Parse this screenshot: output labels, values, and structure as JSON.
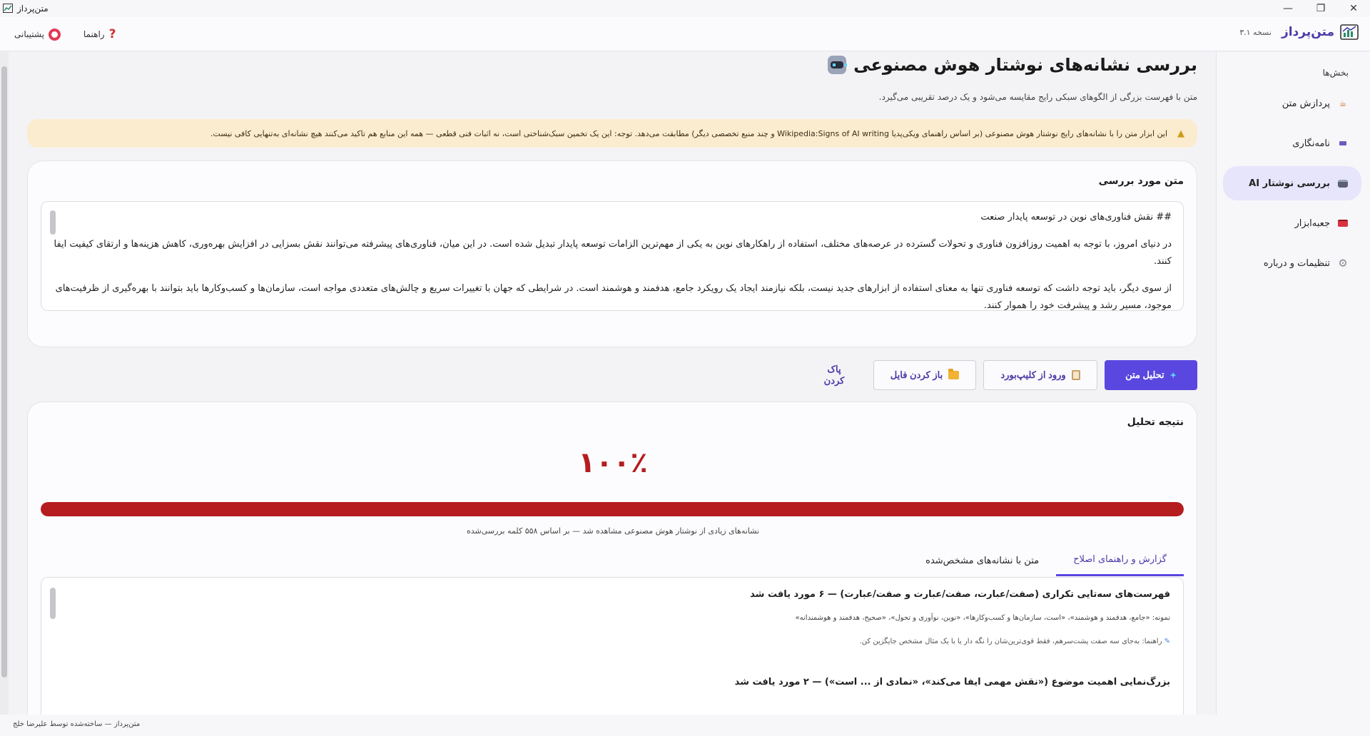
{
  "window": {
    "title": "متن‌پرداز",
    "minimize": "—",
    "restore": "❐",
    "close": "✕"
  },
  "header": {
    "brand_name": "متن‌پرداز",
    "version": "نسخه ۳.۱",
    "help_label": "راهنما",
    "support_label": "پشتیبانی"
  },
  "sidebar": {
    "heading": "بخش‌ها",
    "items": [
      {
        "label": "پردازش متن",
        "icon": "text-processing-icon",
        "active": false
      },
      {
        "label": "نامه‌نگاری",
        "icon": "letter-icon",
        "active": false
      },
      {
        "label": "بررسی نوشتار AI",
        "icon": "robot-icon",
        "active": true
      },
      {
        "label": "جعبه‌ابزار",
        "icon": "toolbox-icon",
        "active": false
      },
      {
        "label": "تنظیمات و درباره",
        "icon": "gear-icon",
        "active": false
      }
    ]
  },
  "main": {
    "title": "بررسی نشانه‌های نوشتار هوش مصنوعی",
    "subtitle": "متن با فهرست بزرگی از الگوهای سبکی رایج مقایسه می‌شود و یک درصد تقریبی می‌گیرد.",
    "alert": "این ابزار متن را با نشانه‌های رایج نوشتار هوش مصنوعی (بر اساس راهنمای ویکی‌پدیا Wikipedia:Signs of AI writing و چند منبع تخصصی دیگر) مطابقت می‌دهد. توجه: این یک تخمین سبک‌شناختی است، نه اثبات فنی قطعی — همه این منابع هم تاکید می‌کنند هیچ نشانه‌ای به‌تنهایی کافی نیست.",
    "input_card": {
      "title": "متن مورد بررسی",
      "paragraphs": [
        "## نقش فناوری‌های نوین در توسعه پایدار صنعت",
        "در دنیای امروز، با توجه به اهمیت روزافزون فناوری و تحولات گسترده در عرصه‌های مختلف، استفاده از راهکارهای نوین به یکی از مهم‌ترین الزامات توسعه پایدار تبدیل شده است. در این میان، فناوری‌های پیشرفته می‌توانند نقش بسزایی در افزایش بهره‌وری، کاهش هزینه‌ها و ارتقای کیفیت ایفا کنند.",
        "از سوی دیگر، باید توجه داشت که توسعه فناوری تنها به معنای استفاده از ابزارهای جدید نیست، بلکه نیازمند ایجاد یک رویکرد جامع، هدفمند و هوشمند است. در شرایطی که جهان با تغییرات سریع و چالش‌های متعددی مواجه است، سازمان‌ها و کسب‌وکارها باید بتوانند با بهره‌گیری از ظرفیت‌های موجود، مسیر رشد و پیشرفت خود را هموار کنند."
      ]
    },
    "actions": {
      "analyze": "تحلیل متن",
      "clipboard": "ورود از کلیپ‌بورد",
      "open_file": "باز کردن فایل",
      "clear": "پاک کردن"
    },
    "result_card": {
      "title": "نتیجه تحلیل",
      "score": "۱۰۰٪",
      "score_fraction": 1.0,
      "caption": "نشانه‌های زیادی از نوشتار هوش مصنوعی مشاهده شد — بر اساس ۵۵۸ کلمه بررسی‌شده",
      "tabs": [
        "گزارش و راهنمای اصلاح",
        "متن با نشانه‌های مشخص‌شده"
      ],
      "issues": [
        {
          "title": "فهرست‌های سه‌تایی تکراری (صفت/عبارت، صفت/عبارت و صفت/عبارت) — ۶ مورد یافت شد",
          "sample": "نمونه: «جامع، هدفمند و هوشمند»، «است، سازمان‌ها و کسب‌وکارها»، «نوین، نوآوری و تحول»، «صحیح، هدفمند و هوشمندانه»",
          "guide": "راهنما: به‌جای سه صفت پشت‌سرهم، فقط قوی‌ترین‌شان را نگه دار یا با یک مثال مشخص جایگزین کن."
        },
        {
          "title": "بزرگ‌نمایی اهمیت موضوع («نقش مهمی ایفا می‌کند»، «نمادی از ... است») — ۲ مورد یافت شد"
        }
      ]
    }
  },
  "footer": {
    "text": "متن‌پرداز — ساخته‌شده توسط علیرضا خلج"
  },
  "colors": {
    "accent": "#5a47e0",
    "danger": "#b51d1f",
    "alert_bg": "#fbecd0",
    "active_nav": "#e6e5fb"
  }
}
